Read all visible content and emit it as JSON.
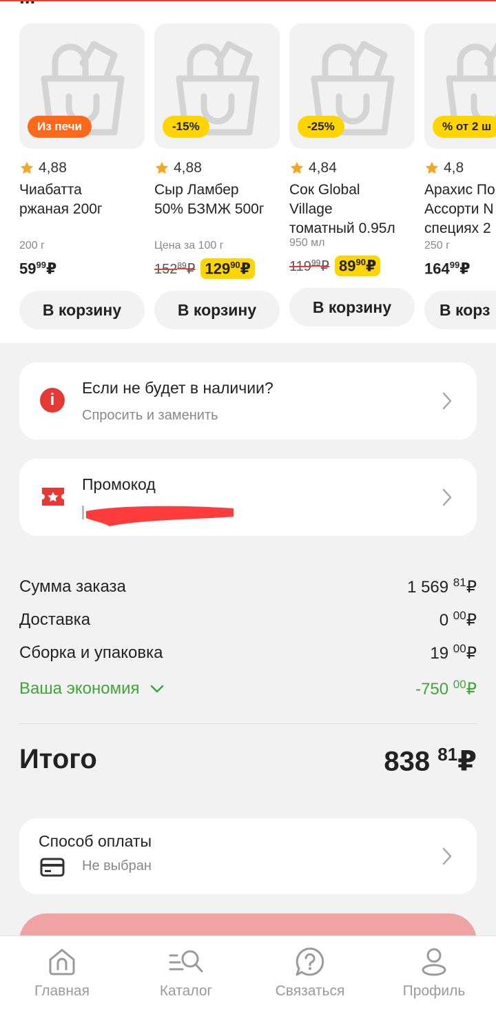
{
  "section_title_cut": "...",
  "products": [
    {
      "badge": "Из печи",
      "badge_style": "orange",
      "rating": "4,88",
      "name": "Чиабатта\nржаная 200г",
      "weight": "200 г",
      "price_main": "59",
      "price_kop": "99",
      "old_main": "",
      "old_kop": "",
      "currency": "₽",
      "cart": "В корзину"
    },
    {
      "badge": "-15%",
      "badge_style": "yellow",
      "rating": "4,88",
      "name": "Сыр Ламбер\n50% БЗМЖ 500г",
      "weight": "Цена за 100 г",
      "price_main": "129",
      "price_kop": "90",
      "old_main": "152",
      "old_kop": "89",
      "currency": "₽",
      "cart": "В корзину"
    },
    {
      "badge": "-25%",
      "badge_style": "yellow",
      "rating": "4,84",
      "name": "Сок Global\nVillage\nтоматный 0.95л",
      "weight": "950 мл",
      "price_main": "89",
      "price_kop": "90",
      "old_main": "119",
      "old_kop": "99",
      "currency": "₽",
      "cart": "В корзину"
    },
    {
      "badge": "% от 2 ш",
      "badge_style": "yellow",
      "rating": "4,8",
      "name": "Арахис По\nАссорти N\nспециях 2",
      "weight": "250 г",
      "price_main": "164",
      "price_kop": "99",
      "old_main": "",
      "old_kop": "",
      "currency": "₽",
      "cart": "В корз"
    }
  ],
  "absent": {
    "title": "Если не будет в наличии?",
    "subtitle": "Спросить и заменить"
  },
  "promo": {
    "title": "Промокод"
  },
  "summary": {
    "order_sum_label": "Сумма заказа",
    "order_sum_main": "1 569",
    "order_sum_kop": "81",
    "delivery_label": "Доставка",
    "delivery_main": "0",
    "delivery_kop": "00",
    "packing_label": "Сборка и упаковка",
    "packing_main": "19",
    "packing_kop": "00",
    "savings_label": "Ваша экономия",
    "savings_main": "-750",
    "savings_kop": "00",
    "currency": "₽"
  },
  "total": {
    "label": "Итого",
    "main": "838",
    "kop": "81",
    "currency": "₽"
  },
  "payment": {
    "title": "Способ оплаты",
    "value": "Не выбран"
  },
  "tabs": [
    {
      "label": "Главная",
      "icon": "home-icon"
    },
    {
      "label": "Каталог",
      "icon": "catalog-search-icon"
    },
    {
      "label": "Связаться",
      "icon": "help-question-icon"
    },
    {
      "label": "Профиль",
      "icon": "profile-icon"
    }
  ],
  "colors": {
    "accent_red": "#e53935",
    "promo_yellow": "#ffd500",
    "badge_orange": "#ff6a1a",
    "savings_green": "#3ea53a",
    "checkout_button": "#f0a3a3"
  }
}
